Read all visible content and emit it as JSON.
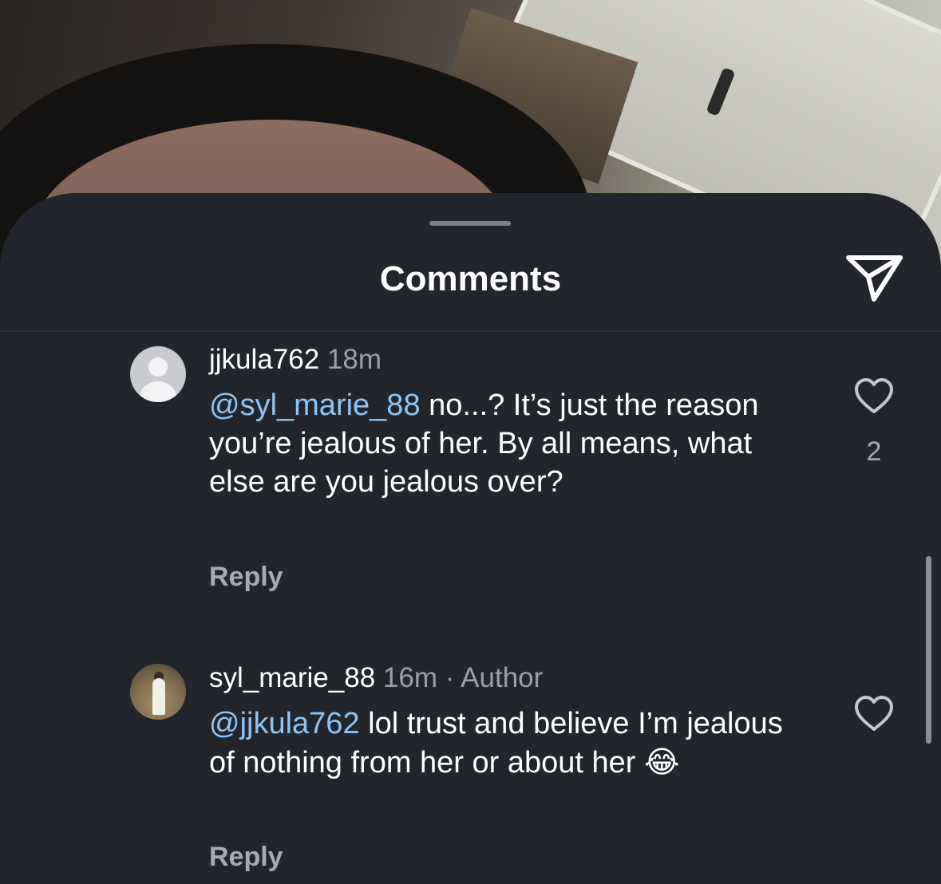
{
  "sheet": {
    "title": "Comments"
  },
  "icons": {
    "share": "paper-plane-icon",
    "like": "heart-outline-icon",
    "default_avatar": "person-placeholder-icon"
  },
  "colors": {
    "sheet_background": "#22262c",
    "mention": "#8fc4f4",
    "secondary_text": "#9aa0a7"
  },
  "comments": [
    {
      "username": "jjkula762",
      "time": "18m",
      "mention": "@syl_marie_88",
      "text": " no...? It’s just the reason you’re jealous of her. By all means, what else are you jealous over?",
      "reply_label": "Reply",
      "like_count": "2"
    },
    {
      "username": "syl_marie_88",
      "time": "16m",
      "separator": " · ",
      "badge": "Author",
      "mention": "@jjkula762",
      "text": " lol trust and believe I’m jealous of nothing from her or about her ",
      "emoji": "😂",
      "reply_label": "Reply"
    }
  ]
}
